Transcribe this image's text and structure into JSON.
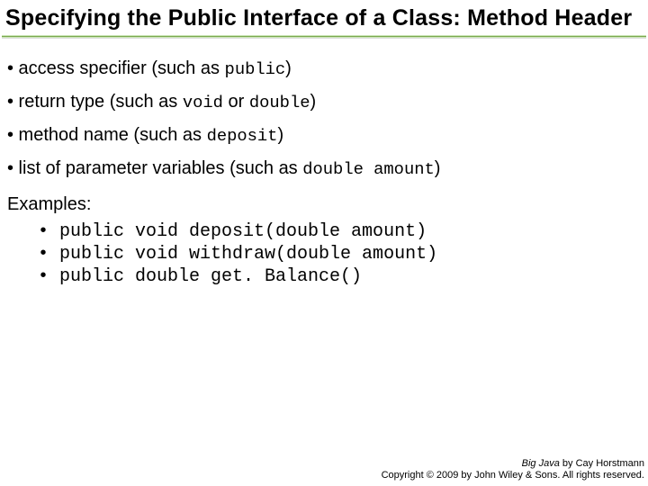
{
  "title": "Specifying the Public Interface of a Class: Method Header",
  "bullets": [
    {
      "pre": "• access specifier (such as ",
      "code": "public",
      "post": ")"
    },
    {
      "pre": "• return type (such as ",
      "code": "void",
      "mid": " or ",
      "code2": "double",
      "post": ")"
    },
    {
      "pre": "• method name (such as ",
      "code": "deposit",
      "post": ")"
    },
    {
      "pre": "• list of parameter variables (such as ",
      "code": "double amount",
      "post": ")"
    }
  ],
  "examples_label": "Examples:",
  "examples": [
    "• public void deposit(double amount)",
    "• public void withdraw(double amount)",
    "• public double get. Balance()"
  ],
  "footer": {
    "book": "Big Java",
    "byline": " by Cay Horstmann",
    "copyright": "Copyright © 2009 by John Wiley & Sons.  All rights reserved."
  }
}
